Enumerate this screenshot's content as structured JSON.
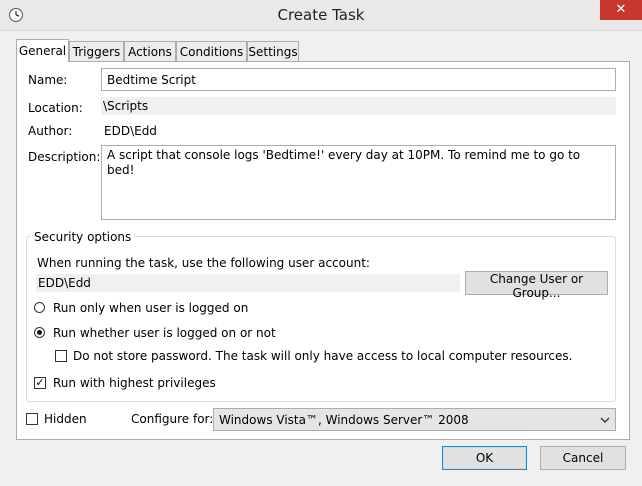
{
  "window": {
    "title": "Create Task",
    "close_label": "✕",
    "icon": "clock-icon"
  },
  "tabs": [
    {
      "label": "General",
      "active": true
    },
    {
      "label": "Triggers",
      "active": false
    },
    {
      "label": "Actions",
      "active": false
    },
    {
      "label": "Conditions",
      "active": false
    },
    {
      "label": "Settings",
      "active": false
    }
  ],
  "general": {
    "name_label": "Name:",
    "name_value": "Bedtime Script",
    "location_label": "Location:",
    "location_value": "\\Scripts",
    "author_label": "Author:",
    "author_value": "EDD\\Edd",
    "description_label": "Description:",
    "description_value": "A script that console logs 'Bedtime!' every day at 10PM. To remind me to go to bed!"
  },
  "security": {
    "title": "Security options",
    "account_prompt": "When running the task, use the following user account:",
    "account_value": "EDD\\Edd",
    "change_button": "Change User or Group...",
    "radio_logged_on": {
      "label": "Run only when user is logged on",
      "checked": false
    },
    "radio_whether": {
      "label": "Run whether user is logged on or not",
      "checked": true
    },
    "no_store_password": {
      "label": "Do not store password.  The task will only have access to local computer resources.",
      "checked": false
    },
    "highest_privileges": {
      "label": "Run with highest privileges",
      "checked": true
    }
  },
  "bottom": {
    "hidden_label": "Hidden",
    "hidden_checked": false,
    "configure_label": "Configure for:",
    "configure_value": "Windows Vista™, Windows Server™ 2008"
  },
  "buttons": {
    "ok": "OK",
    "cancel": "Cancel"
  },
  "colors": {
    "close_button": "#c7372e",
    "dialog_bg": "#f0f0f0",
    "primary_border": "#3c7fb1"
  }
}
